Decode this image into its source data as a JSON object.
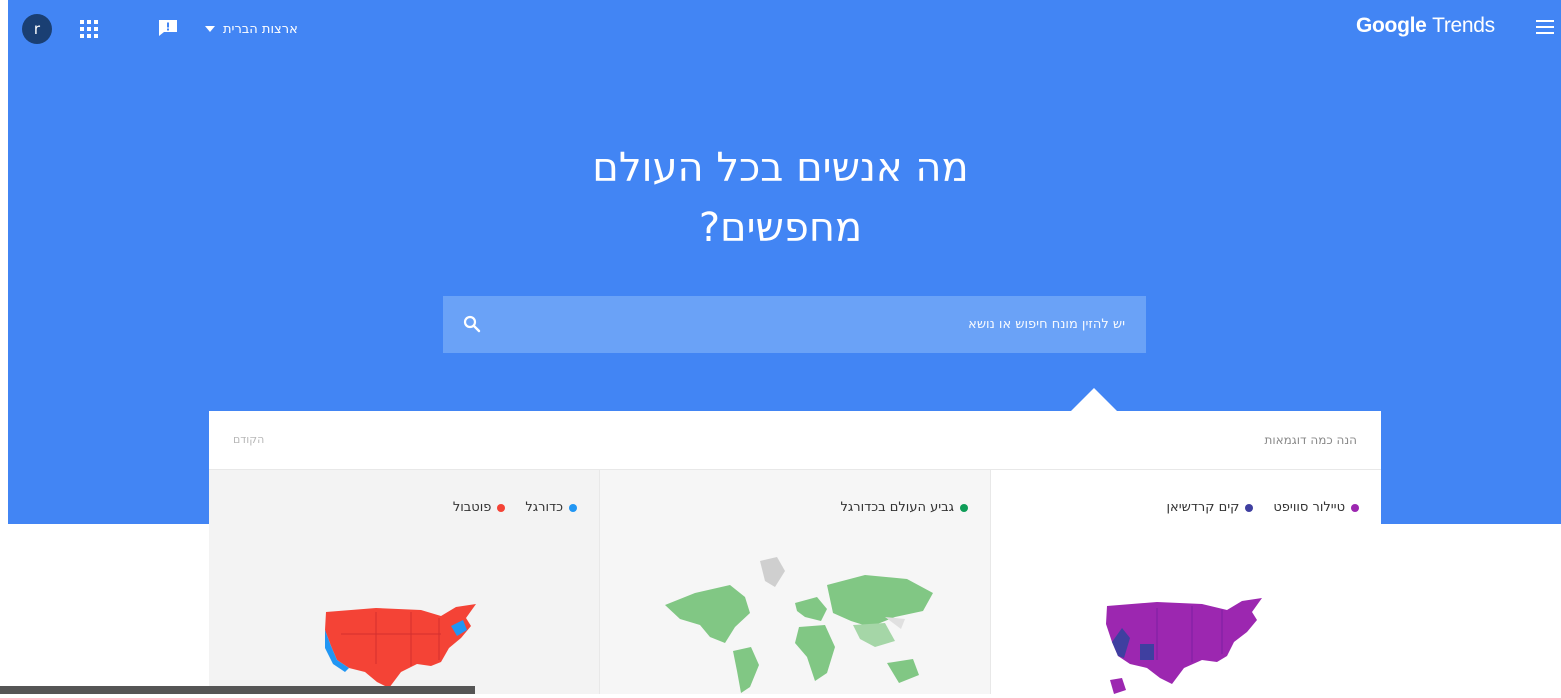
{
  "topbar": {
    "avatar_letter": "r",
    "region_label": "ארצות הברית",
    "logo_google": "Google",
    "logo_trends": "Trends",
    "icons": [
      "account-avatar-icon",
      "apps-grid-icon",
      "feedback-icon",
      "dropdown-caret-icon",
      "hamburger-menu-icon"
    ]
  },
  "hero": {
    "headline_line1": "מה אנשים בכל העולם",
    "headline_line2": "מחפשים?",
    "background": "#4285f4"
  },
  "search": {
    "placeholder": "יש להזין מונח חיפוש או נושא",
    "icon": "search-icon"
  },
  "examples": {
    "title": "הנה כמה דוגמאות",
    "prev_label": "הקודם",
    "cards": [
      {
        "legend": [
          {
            "label": "טיילור סוויפט",
            "color": "#9c27b0"
          },
          {
            "label": "קים קרדשיאן",
            "color": "#3f3fa0"
          }
        ],
        "map": "usa-map"
      },
      {
        "legend": [
          {
            "label": "גביע העולם בכדורגל",
            "color": "#0f9d58"
          }
        ],
        "map": "world-map"
      },
      {
        "legend": [
          {
            "label": "כדורגל",
            "color": "#2196f3"
          },
          {
            "label": "פוטבול",
            "color": "#f44336"
          }
        ],
        "map": "usa-map"
      }
    ]
  }
}
